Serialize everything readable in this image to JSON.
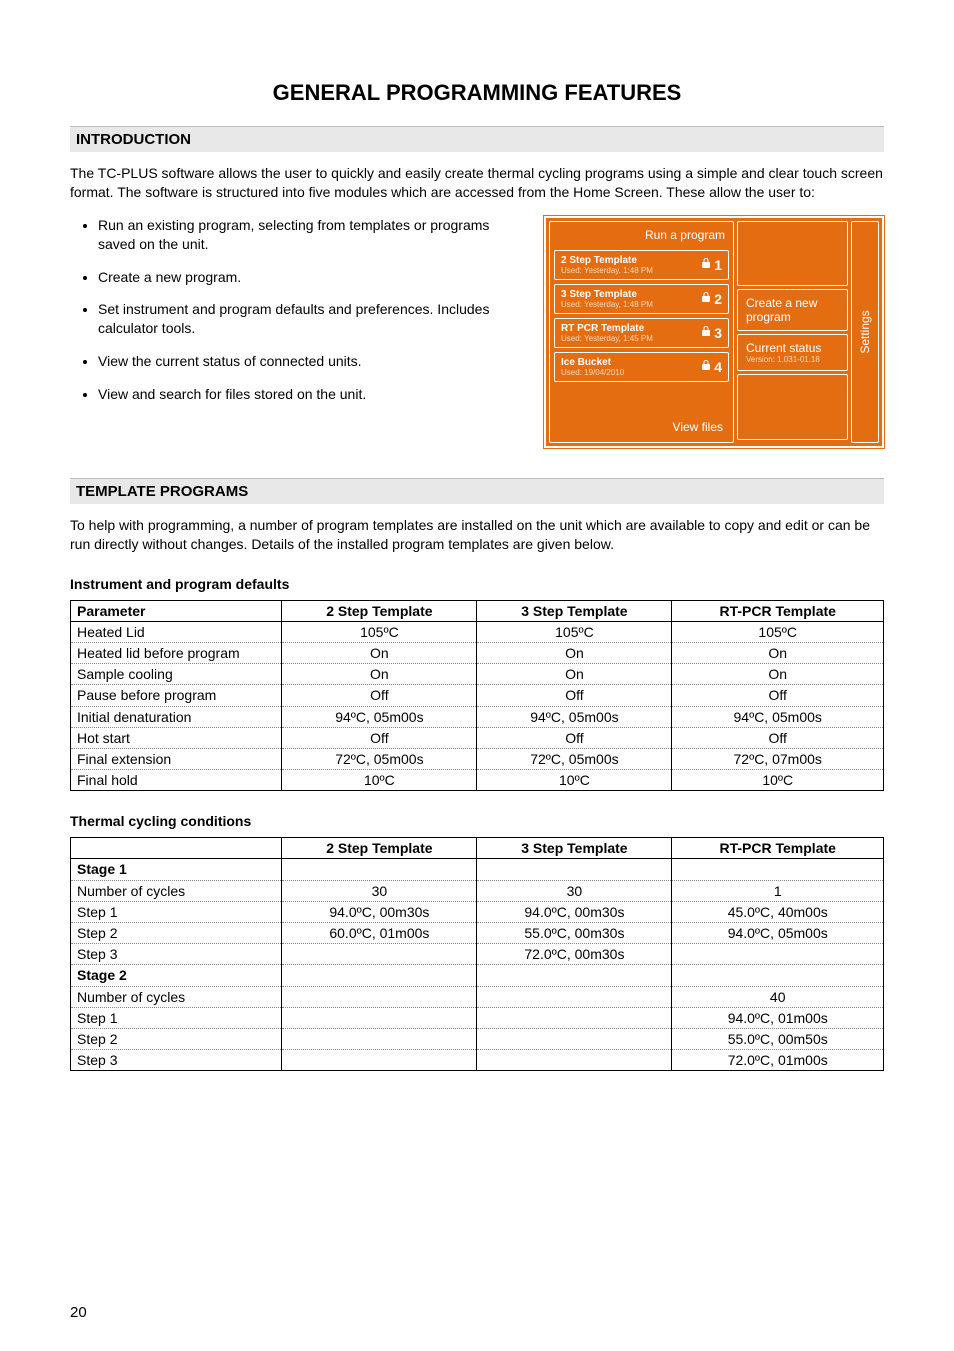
{
  "page": {
    "number": "20"
  },
  "title": "GENERAL PROGRAMMING FEATURES",
  "intro": {
    "heading": "INTRODUCTION",
    "para": "The TC-PLUS software allows the user to quickly and easily create thermal cycling programs using a simple and clear touch screen format. The software is structured into five modules which are accessed from the Home Screen. These allow the user to:",
    "bullets": [
      "Run an existing program, selecting from templates or programs saved on the unit.",
      "Create a new program.",
      "Set instrument and program defaults and preferences. Includes calculator tools.",
      "View the current status of connected units.",
      "View and search for files stored on the unit."
    ]
  },
  "figure": {
    "run_title": "Run a program",
    "templates": [
      {
        "name": "2 Step Template",
        "used": "Used: Yesterday, 1:48 PM",
        "num": "1"
      },
      {
        "name": "3 Step Template",
        "used": "Used: Yesterday, 1:48 PM",
        "num": "2"
      },
      {
        "name": "RT PCR Template",
        "used": "Used: Yesterday, 1:45 PM",
        "num": "3"
      },
      {
        "name": "Ice Bucket",
        "used": "Used: 19/04/2010",
        "num": "4"
      }
    ],
    "view_files": "View files",
    "create": "Create a new program",
    "status": "Current status",
    "version": "Version: 1.031-01.18",
    "settings": "Settings"
  },
  "templates_section": {
    "heading": "TEMPLATE PROGRAMS",
    "para": "To help with programming, a number of program templates are installed on the unit which are available to copy and edit or can be run directly without changes. Details of the installed program templates are given below.",
    "defaults_heading": "Instrument and program defaults",
    "defaults_table": {
      "headers": [
        "Parameter",
        "2 Step Template",
        "3 Step Template",
        "RT-PCR Template"
      ],
      "rows": [
        [
          "Heated Lid",
          "105ºC",
          "105ºC",
          "105ºC"
        ],
        [
          "Heated lid before program",
          "On",
          "On",
          "On"
        ],
        [
          "Sample cooling",
          "On",
          "On",
          "On"
        ],
        [
          "Pause before program",
          "Off",
          "Off",
          "Off"
        ],
        [
          "Initial denaturation",
          "94ºC, 05m00s",
          "94ºC, 05m00s",
          "94ºC, 05m00s"
        ],
        [
          "Hot start",
          "Off",
          "Off",
          "Off"
        ],
        [
          "Final extension",
          "72ºC, 05m00s",
          "72ºC, 05m00s",
          "72ºC, 07m00s"
        ],
        [
          "Final hold",
          "10ºC",
          "10ºC",
          "10ºC"
        ]
      ]
    },
    "cycling_heading": "Thermal cycling conditions",
    "cycling_table": {
      "headers": [
        "",
        "2 Step Template",
        "3 Step Template",
        "RT-PCR Template"
      ],
      "rows": [
        {
          "type": "stage",
          "cells": [
            "Stage 1",
            "",
            "",
            ""
          ]
        },
        {
          "type": "data",
          "cells": [
            "Number of cycles",
            "30",
            "30",
            "1"
          ]
        },
        {
          "type": "data",
          "cells": [
            "Step 1",
            "94.0ºC, 00m30s",
            "94.0ºC, 00m30s",
            "45.0ºC, 40m00s"
          ]
        },
        {
          "type": "data",
          "cells": [
            "Step 2",
            "60.0ºC, 01m00s",
            "55.0ºC, 00m30s",
            "94.0ºC, 05m00s"
          ]
        },
        {
          "type": "data",
          "cells": [
            "Step 3",
            "",
            "72.0ºC, 00m30s",
            ""
          ]
        },
        {
          "type": "stage",
          "cells": [
            "Stage 2",
            "",
            "",
            ""
          ]
        },
        {
          "type": "data",
          "cells": [
            "Number of cycles",
            "",
            "",
            "40"
          ]
        },
        {
          "type": "data",
          "cells": [
            "Step 1",
            "",
            "",
            "94.0ºC, 01m00s"
          ]
        },
        {
          "type": "data",
          "cells": [
            "Step 2",
            "",
            "",
            "55.0ºC, 00m50s"
          ]
        },
        {
          "type": "last",
          "cells": [
            "Step 3",
            "",
            "",
            "72.0ºC, 01m00s"
          ]
        }
      ]
    }
  }
}
